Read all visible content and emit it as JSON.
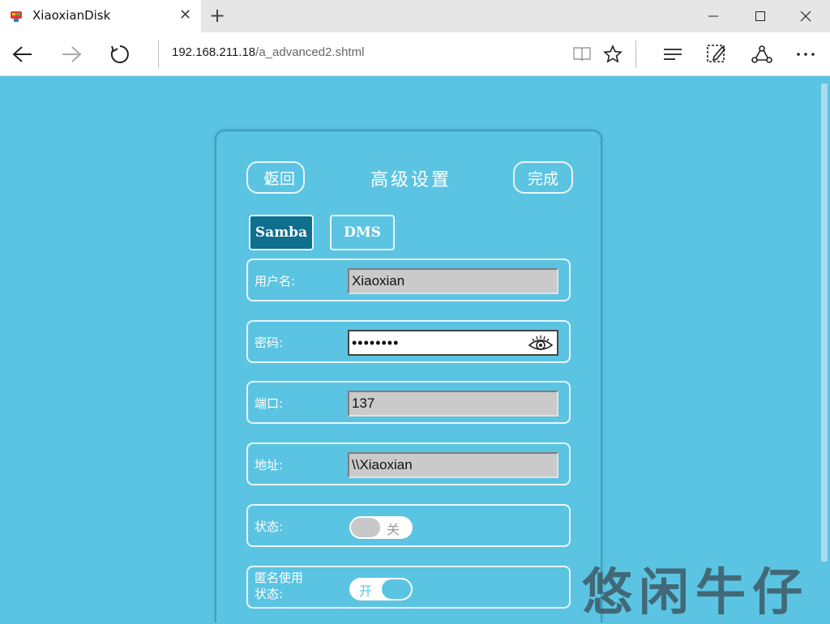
{
  "browser": {
    "tab_title": "XiaoxianDisk",
    "url_host": "192.168.211.18",
    "url_path": "/a_advanced2.shtml"
  },
  "header": {
    "back_label": "返回",
    "title": "高级设置",
    "done_label": "完成"
  },
  "segments": [
    {
      "label": "Samba",
      "selected": true
    },
    {
      "label": "DMS",
      "selected": false
    }
  ],
  "form": {
    "username": {
      "label": "用户名:",
      "value": "Xiaoxian"
    },
    "password": {
      "label": "密码:",
      "value": "••••••••"
    },
    "port": {
      "label": "端口:",
      "value": "137"
    },
    "address": {
      "label": "地址:",
      "value": "\\\\Xiaoxian"
    },
    "status": {
      "label": "状态:",
      "toggle_text": "关",
      "on": false
    },
    "anonymous": {
      "label_line1": "匿名使用",
      "label_line2": "状态:",
      "toggle_text": "开",
      "on": true
    }
  },
  "watermark": "悠闲牛仔",
  "colors": {
    "page_bg": "#5bc4e2",
    "segment_selected": "#0e6f8e",
    "border_light": "#e8f6fb"
  }
}
